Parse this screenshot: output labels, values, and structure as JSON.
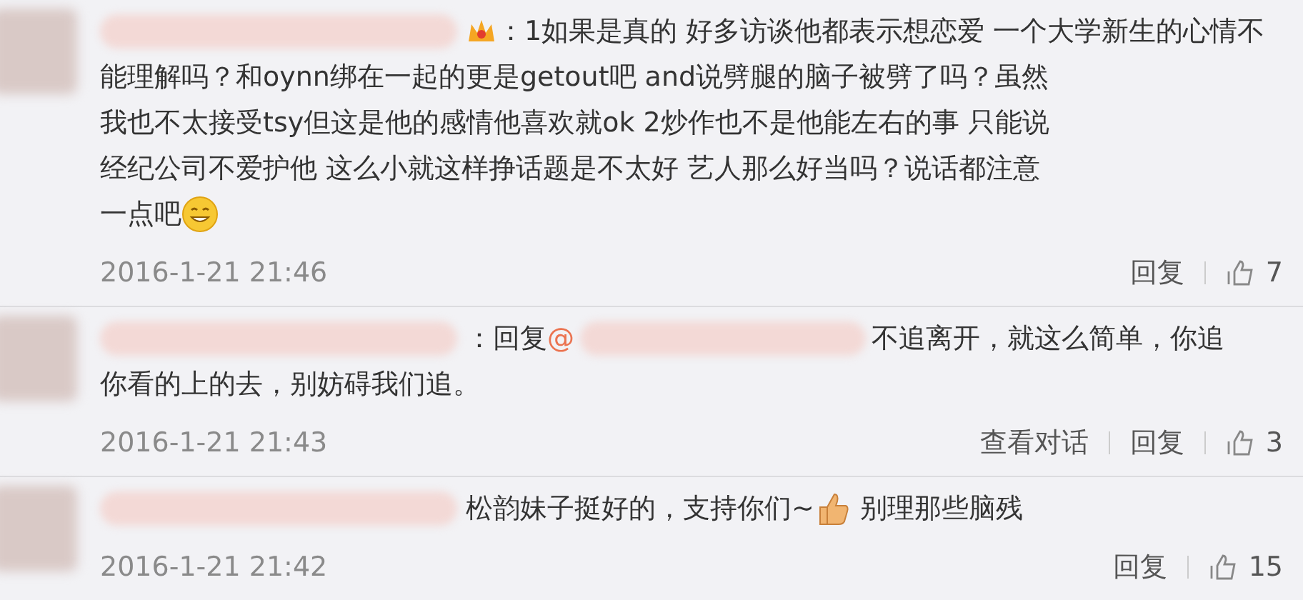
{
  "comments": [
    {
      "lines": [
        [
          {
            "kind": "blur"
          },
          {
            "kind": "badge"
          },
          {
            "kind": "text",
            "text": "：1如果是真的 好多访谈他都表示想恋爱 一个大学新生的心情不"
          }
        ],
        [
          {
            "kind": "text",
            "text": "能理解吗？和oynn绑在一起的更是getout吧 and说劈腿的脑子被劈了吗？虽然"
          }
        ],
        [
          {
            "kind": "text",
            "text": "我也不太接受tsy但这是他的感情他喜欢就ok 2炒作也不是他能左右的事 只能说"
          }
        ],
        [
          {
            "kind": "text",
            "text": "经纪公司不爱护他 这么小就这样挣话题是不太好 艺人那么好当吗？说话都注意"
          }
        ],
        [
          {
            "kind": "text",
            "text": "一点吧"
          },
          {
            "kind": "smiley"
          }
        ]
      ],
      "time": "2016-1-21 21:46",
      "actions": [
        "回复"
      ],
      "likes": "7"
    },
    {
      "lines": [
        [
          {
            "kind": "blur"
          },
          {
            "kind": "text",
            "text": "：回复"
          },
          {
            "kind": "mention",
            "text": "@"
          },
          {
            "kind": "blur"
          },
          {
            "kind": "text",
            "text": "不追离开，就这么简单，你追"
          }
        ],
        [
          {
            "kind": "text",
            "text": "你看的上的去，别妨碍我们追。"
          }
        ]
      ],
      "time": "2016-1-21 21:43",
      "actions": [
        "查看对话",
        "回复"
      ],
      "likes": "3"
    },
    {
      "lines": [
        [
          {
            "kind": "blur"
          },
          {
            "kind": "text",
            "text": "松韵妹子挺好的，支持你们~"
          },
          {
            "kind": "thumb"
          },
          {
            "kind": "text",
            "text": " 别理那些脑残"
          }
        ]
      ],
      "time": "2016-1-21 21:42",
      "actions": [
        "回复"
      ],
      "likes": "15"
    }
  ]
}
